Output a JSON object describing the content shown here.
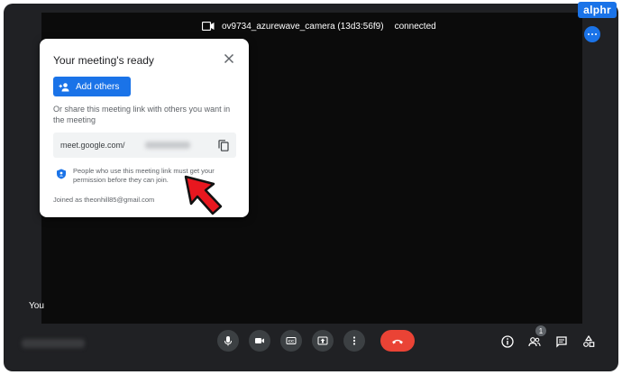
{
  "watermark": "alphr",
  "camera": {
    "name": "ov9734_azurewave_camera (13d3:56f9)",
    "status": "connected"
  },
  "self_label": "You",
  "dialog": {
    "title": "Your meeting's ready",
    "add_button_label": "Add others",
    "share_text": "Or share this meeting link with others you want in the meeting",
    "link_text": "meet.google.com/",
    "permission_text": "People who use this meeting link must get your permission before they can join.",
    "joined_text": "Joined as theonhill85@gmail.com"
  },
  "participants_count": "1",
  "colors": {
    "accent": "#1a73e8",
    "end_call": "#ea4335",
    "arrow": "#e8171f"
  },
  "icons": {
    "camera_banner": "camera-icon",
    "close": "close-icon",
    "add_person": "add-person-icon",
    "copy": "copy-icon",
    "shield": "shield-icon",
    "mic": "mic-icon",
    "video": "video-icon",
    "captions": "captions-icon",
    "present": "present-icon",
    "more": "more-vert-icon",
    "end_call": "end-call-icon",
    "info": "info-icon",
    "people": "people-icon",
    "chat": "chat-icon",
    "activities": "activities-icon"
  }
}
